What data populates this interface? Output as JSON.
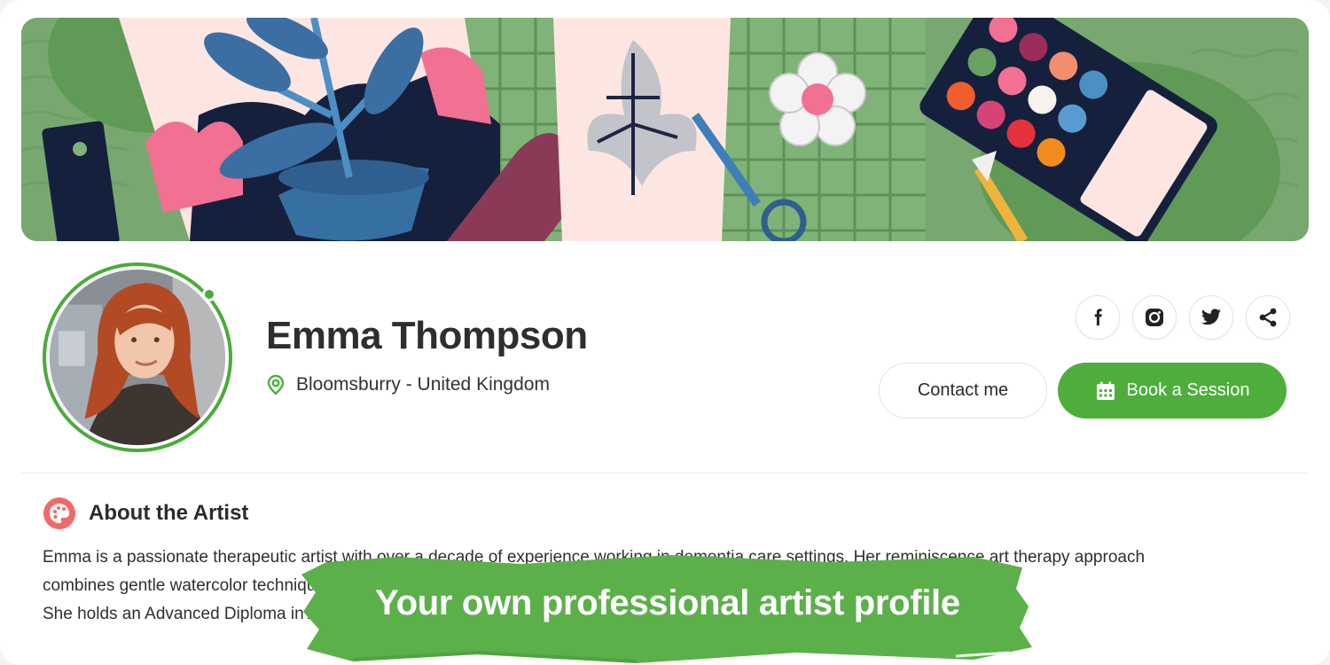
{
  "profile": {
    "name": "Emma Thompson",
    "location": "Bloomsburry - United Kingdom",
    "online": true
  },
  "social": [
    {
      "icon": "facebook-icon"
    },
    {
      "icon": "instagram-icon"
    },
    {
      "icon": "twitter-icon"
    },
    {
      "icon": "share-icon"
    }
  ],
  "actions": {
    "contact_label": "Contact me",
    "book_label": "Book a Session"
  },
  "about": {
    "title": "About the Artist",
    "lines": [
      "Emma is a passionate therapeutic artist with over a decade of experience working in dementia care settings. Her reminiscence art therapy approach",
      "combines gentle watercolor techniques with memory-focused conversations, creating meaningful moments for residents.",
      "She holds an Advanced Diploma in Art Therapy"
    ]
  },
  "overlay": {
    "caption": "Your own professional artist profile"
  },
  "colors": {
    "accent": "#4dae3c",
    "banner_green": "#78a86f",
    "about_icon": "#f06a6a"
  }
}
